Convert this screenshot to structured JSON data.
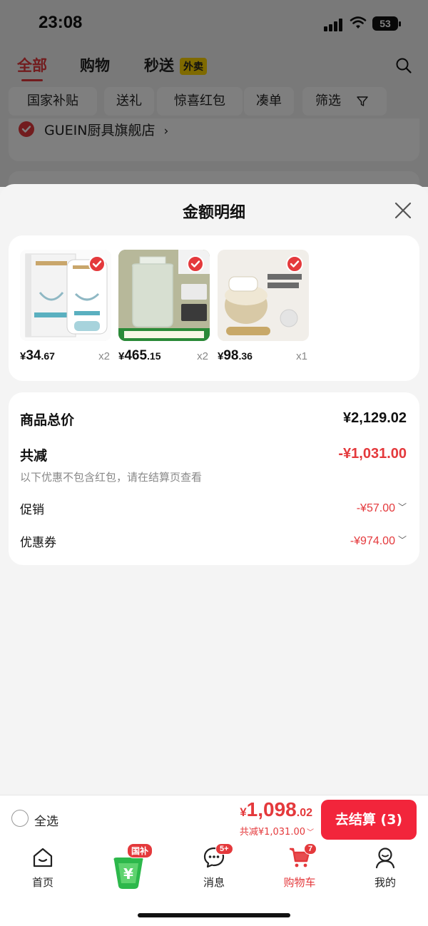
{
  "status_bar": {
    "time": "23:08",
    "battery": "53"
  },
  "top_nav": {
    "tabs": [
      {
        "label": "全部",
        "active": true
      },
      {
        "label": "购物",
        "active": false
      },
      {
        "label": "秒送",
        "active": false
      }
    ],
    "waimai_badge": "外卖"
  },
  "filter_chips": [
    "国家补贴",
    "送礼",
    "惊喜红包",
    "凑单",
    "筛选"
  ],
  "store": {
    "name": "GUEIN厨具旗舰店",
    "arrow": "›"
  },
  "sheet": {
    "title": "金额明细",
    "products": [
      {
        "name": "neck-cream",
        "yen": "¥",
        "int": "34",
        "dec": ".67",
        "qty": "x2",
        "checked": true
      },
      {
        "name": "glass-jar",
        "yen": "¥",
        "int": "465",
        "dec": ".15",
        "qty": "x2",
        "checked": true
      },
      {
        "name": "face-cream",
        "yen": "¥",
        "int": "98",
        "dec": ".36",
        "qty": "x1",
        "checked": true
      }
    ],
    "summary": {
      "goods_total_label": "商品总价",
      "goods_total_value": "¥2,129.02",
      "discount_label": "共减",
      "discount_value": "-¥1,031.00",
      "hint": "以下优惠不包含红包，请在结算页查看",
      "promo_label": "促销",
      "promo_value": "-¥57.00",
      "coupon_label": "优惠券",
      "coupon_value": "-¥974.00"
    }
  },
  "checkout": {
    "select_all_label": "全选",
    "total_yen": "¥",
    "total_int": "1,098",
    "total_dec": ".02",
    "total_discount": "共减¥1,031.00",
    "button_label": "去结算 (3)"
  },
  "tab_bar": {
    "items": [
      {
        "label": "首页",
        "icon": "home-icon"
      },
      {
        "label": "",
        "icon": "national-subsidy-icon",
        "badge": "国补"
      },
      {
        "label": "消息",
        "icon": "message-icon",
        "badge": "5+"
      },
      {
        "label": "购物车",
        "icon": "cart-icon",
        "badge": "7",
        "active": true
      },
      {
        "label": "我的",
        "icon": "profile-icon"
      }
    ]
  },
  "colors": {
    "accent": "#e4393c",
    "checkout_button": "#f2253b",
    "badge_yellow": "#ffd400"
  }
}
